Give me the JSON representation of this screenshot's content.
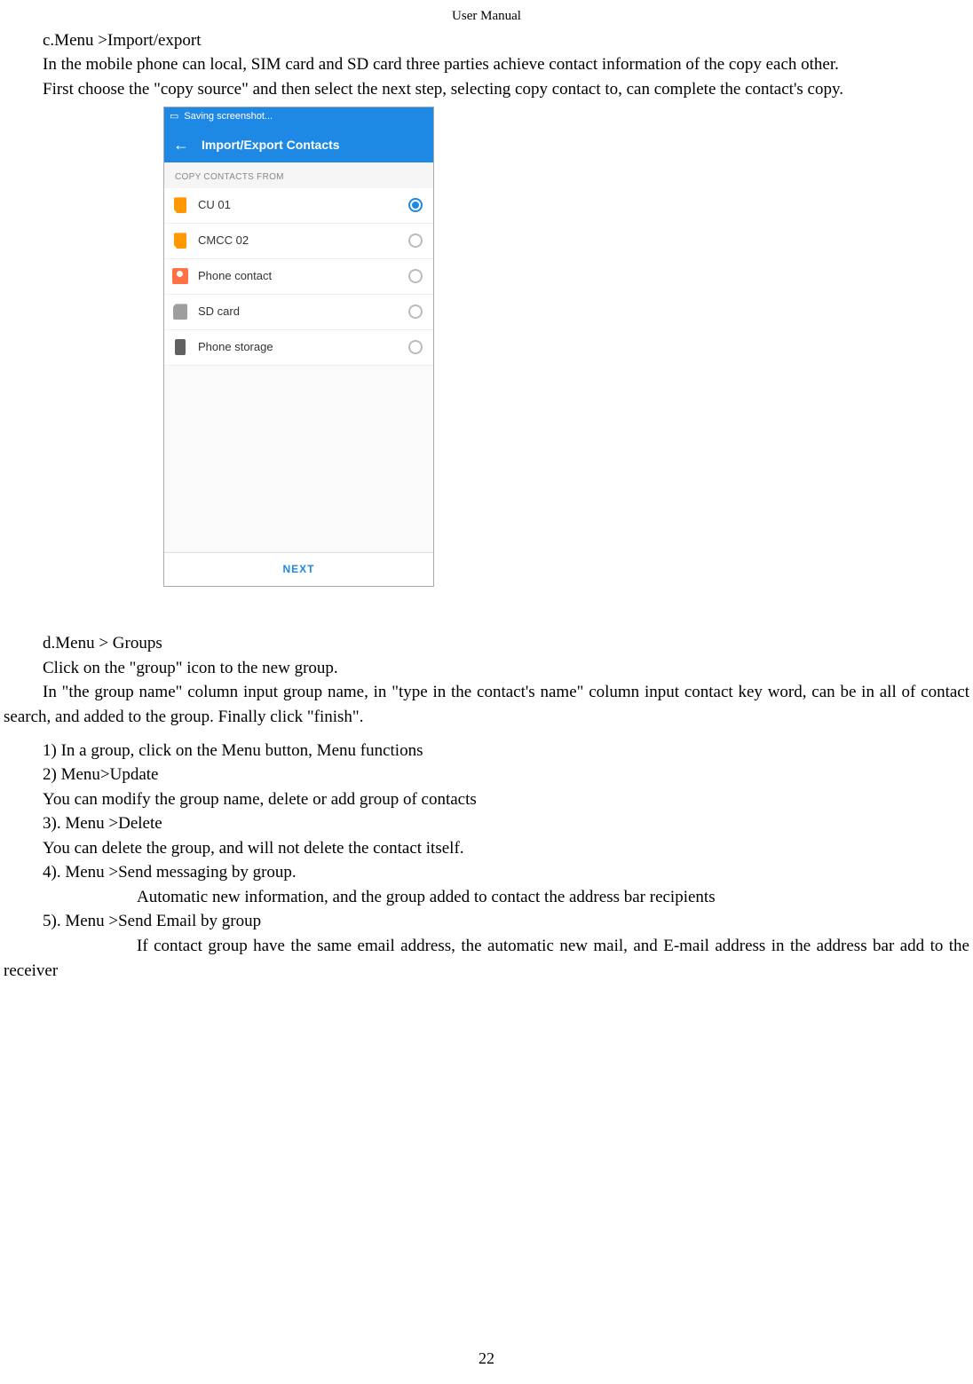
{
  "header": {
    "title": "User    Manual"
  },
  "text": {
    "c_title": "c.Menu >Import/export",
    "c_p1": "In the mobile phone can local, SIM card and SD card three parties achieve contact information of the copy each other.",
    "c_p2": "First choose the \"copy source\" and then select the next step, selecting copy contact to, can complete the contact's copy.",
    "d_title": "d.Menu > Groups",
    "d_p1": "Click on the \"group\" icon to the new group.",
    "d_p2": "In \"the group name\" column input group name, in \"type in the contact's name\" column input contact key word, can be in all of contact search, and added to the group. Finally click \"finish\".",
    "l1": "1)    In a group, click on the Menu button,    Menu functions",
    "l2": "2)    Menu>Update",
    "l2b": "You can modify the group name, delete or add group of contacts",
    "l3": "3).    Menu >Delete",
    "l3b": "You can delete the group, and will not delete the contact itself.",
    "l4": "4).    Menu >Send messaging by group.",
    "l4b": "Automatic new information, and the group added to contact the address bar recipients",
    "l5": "5).    Menu >Send Email by group",
    "l5b": "If contact group have the same email address, the automatic new mail, and E-mail address in the address bar add to the receiver"
  },
  "phone": {
    "statusbar": {
      "toast": "Saving screenshot..."
    },
    "appbar": {
      "title": "Import/Export Contacts"
    },
    "section": "COPY CONTACTS FROM",
    "items": [
      {
        "label": "CU 01",
        "icon": "sim",
        "selected": true
      },
      {
        "label": "CMCC 02",
        "icon": "sim",
        "selected": false
      },
      {
        "label": "Phone contact",
        "icon": "contact",
        "selected": false
      },
      {
        "label": "SD card",
        "icon": "sd",
        "selected": false
      },
      {
        "label": "Phone storage",
        "icon": "phone",
        "selected": false
      }
    ],
    "next": "NEXT"
  },
  "page": {
    "number": "22"
  }
}
